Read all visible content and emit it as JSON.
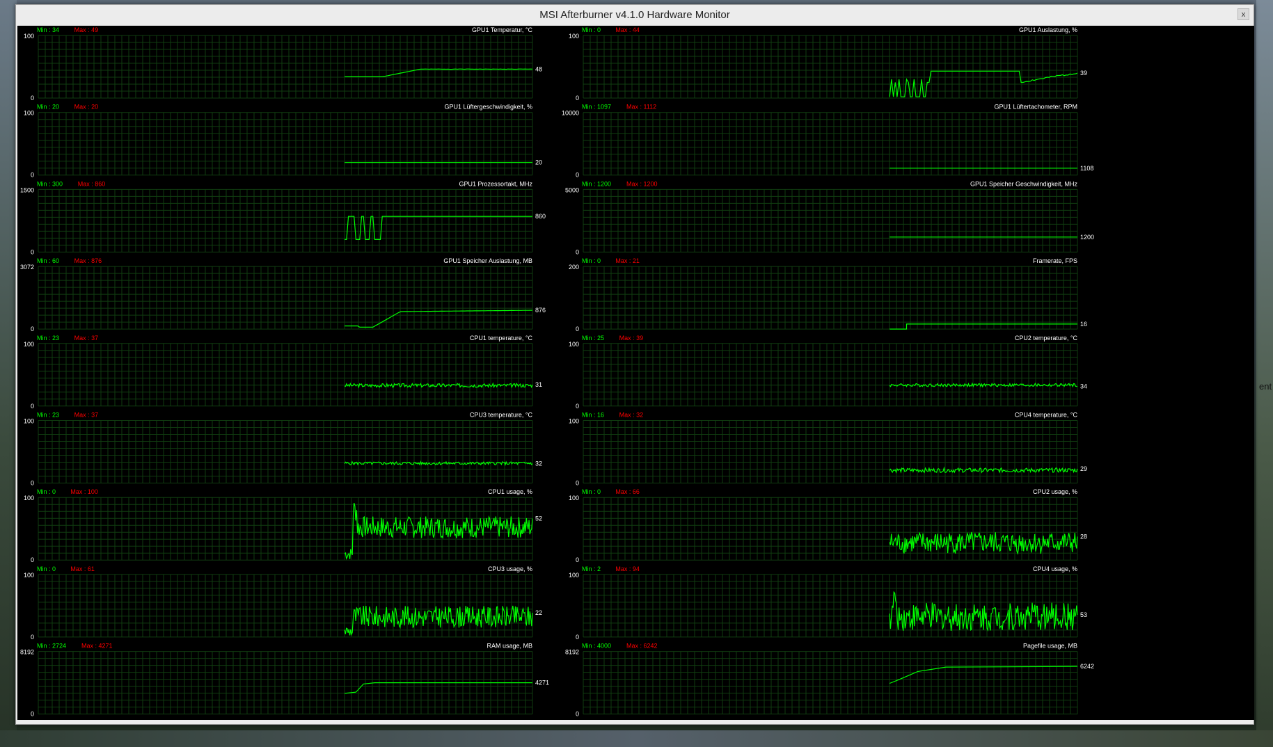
{
  "window": {
    "title": "MSI Afterburner v4.1.0 Hardware Monitor",
    "close_label": "x"
  },
  "desktop_text": "ent",
  "colors": {
    "background": "#000000",
    "grid": "#103d10",
    "line": "#00ff00",
    "min_label": "#00ff00",
    "max_label": "#ff0000",
    "text": "#ffffff"
  },
  "graphs": [
    {
      "title": "GPU1 Temperatur, °C",
      "min_label": "Min : 34",
      "max_label": "Max : 49",
      "y_top": "100",
      "y_bottom": "0",
      "y_max": 100,
      "current": "48"
    },
    {
      "title": "GPU1 Auslastung, %",
      "min_label": "Min : 0",
      "max_label": "Max : 44",
      "y_top": "100",
      "y_bottom": "0",
      "y_max": 100,
      "current": "39"
    },
    {
      "title": "GPU1 Lüftergeschwindigkeit, %",
      "min_label": "Min : 20",
      "max_label": "Max : 20",
      "y_top": "100",
      "y_bottom": "0",
      "y_max": 100,
      "current": "20"
    },
    {
      "title": "GPU1 Lüftertachometer, RPM",
      "min_label": "Min : 1097",
      "max_label": "Max : 1112",
      "y_top": "10000",
      "y_bottom": "0",
      "y_max": 10000,
      "current": "1108"
    },
    {
      "title": "GPU1 Prozessortakt, MHz",
      "min_label": "Min : 300",
      "max_label": "Max : 860",
      "y_top": "1500",
      "y_bottom": "0",
      "y_max": 1500,
      "current": "860"
    },
    {
      "title": "GPU1 Speicher Geschwindigkeit, MHz",
      "min_label": "Min : 1200",
      "max_label": "Max : 1200",
      "y_top": "5000",
      "y_bottom": "0",
      "y_max": 5000,
      "current": "1200"
    },
    {
      "title": "GPU1 Speicher Auslastung, MB",
      "min_label": "Min : 60",
      "max_label": "Max : 876",
      "y_top": "3072",
      "y_bottom": "0",
      "y_max": 3072,
      "current": "876"
    },
    {
      "title": "Framerate, FPS",
      "min_label": "Min : 0",
      "max_label": "Max : 21",
      "y_top": "200",
      "y_bottom": "0",
      "y_max": 200,
      "current": "16"
    },
    {
      "title": "CPU1 temperature, °C",
      "min_label": "Min : 23",
      "max_label": "Max : 37",
      "y_top": "100",
      "y_bottom": "0",
      "y_max": 100,
      "current": "31"
    },
    {
      "title": "CPU2 temperature, °C",
      "min_label": "Min : 25",
      "max_label": "Max : 39",
      "y_top": "100",
      "y_bottom": "0",
      "y_max": 100,
      "current": "34"
    },
    {
      "title": "CPU3 temperature, °C",
      "min_label": "Min : 23",
      "max_label": "Max : 37",
      "y_top": "100",
      "y_bottom": "0",
      "y_max": 100,
      "current": "32"
    },
    {
      "title": "CPU4 temperature, °C",
      "min_label": "Min : 16",
      "max_label": "Max : 32",
      "y_top": "100",
      "y_bottom": "0",
      "y_max": 100,
      "current": "29"
    },
    {
      "title": "CPU1 usage, %",
      "min_label": "Min : 0",
      "max_label": "Max : 100",
      "y_top": "100",
      "y_bottom": "0",
      "y_max": 100,
      "current": "52"
    },
    {
      "title": "CPU2 usage, %",
      "min_label": "Min : 0",
      "max_label": "Max : 66",
      "y_top": "100",
      "y_bottom": "0",
      "y_max": 100,
      "current": "28"
    },
    {
      "title": "CPU3 usage, %",
      "min_label": "Min : 0",
      "max_label": "Max : 61",
      "y_top": "100",
      "y_bottom": "0",
      "y_max": 100,
      "current": "22"
    },
    {
      "title": "CPU4 usage, %",
      "min_label": "Min : 2",
      "max_label": "Max : 94",
      "y_top": "100",
      "y_bottom": "0",
      "y_max": 100,
      "current": "53"
    },
    {
      "title": "RAM usage, MB",
      "min_label": "Min : 2724",
      "max_label": "Max : 4271",
      "y_top": "8192",
      "y_bottom": "0",
      "y_max": 8192,
      "current": "4271"
    },
    {
      "title": "Pagefile usage, MB",
      "min_label": "Min : 4000",
      "max_label": "Max : 6242",
      "y_top": "8192",
      "y_bottom": "0",
      "y_max": 8192,
      "current": "6242"
    }
  ]
}
